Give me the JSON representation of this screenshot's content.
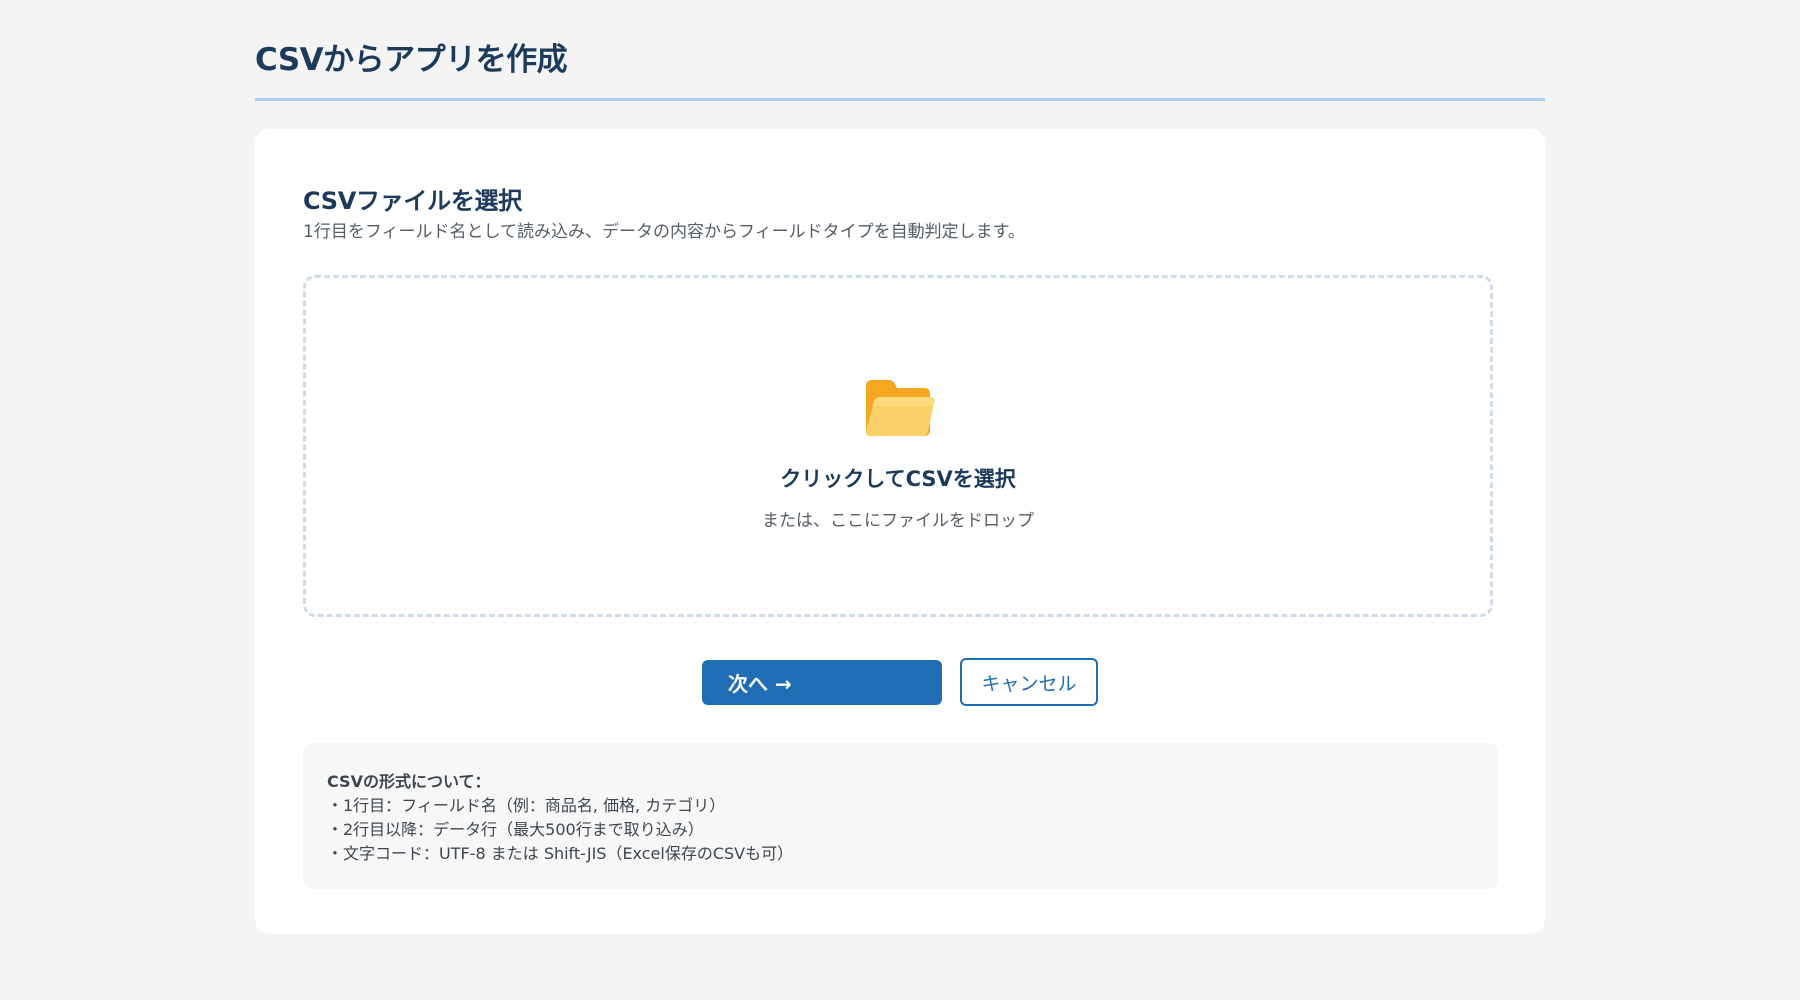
{
  "header": {
    "title": "CSVからアプリを作成"
  },
  "card": {
    "section_title": "CSVファイルを選択",
    "section_desc": "1行目をフィールド名として読み込み、データの内容からフィールドタイプを自動判定します。"
  },
  "dropzone": {
    "icon": "folder-open-icon",
    "title": "クリックしてCSVを選択",
    "subtitle": "または、ここにファイルをドロップ"
  },
  "actions": {
    "next_label": "次へ →",
    "cancel_label": "キャンセル"
  },
  "info": {
    "title": "CSVの形式について：",
    "lines": [
      "・1行目：フィールド名（例：商品名, 価格, カテゴリ）",
      "・2行目以降：データ行（最大500行まで取り込み）",
      "・文字コード：UTF-8 または Shift-JIS（Excel保存のCSVも可）"
    ]
  },
  "colors": {
    "primary": "#1e6db5",
    "heading": "#1c3b5c",
    "header_rule": "#a9d1f5",
    "dropzone_border": "#cfdbe6",
    "folder": "#f7b733"
  }
}
